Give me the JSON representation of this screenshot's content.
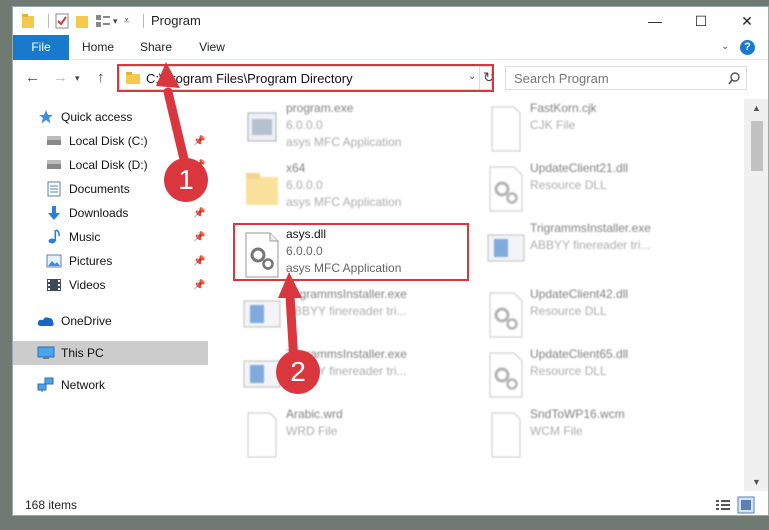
{
  "window": {
    "title": "Program",
    "controls": {
      "minimize": "—",
      "maximize": "☐",
      "close": "✕"
    }
  },
  "ribbon": {
    "tabs": [
      "File",
      "Home",
      "Share",
      "View"
    ],
    "help": "?"
  },
  "address_bar": {
    "path": "C:\\Program Files\\Program Directory"
  },
  "search": {
    "placeholder": "Search Program"
  },
  "sidebar": {
    "items": [
      {
        "label": "Quick access",
        "icon": "star-icon"
      },
      {
        "label": "Local Disk (C:)",
        "icon": "drive-icon",
        "pinned": true
      },
      {
        "label": "Local Disk (D:)",
        "icon": "drive-icon",
        "pinned": true
      },
      {
        "label": "Documents",
        "icon": "documents-icon",
        "pinned": true
      },
      {
        "label": "Downloads",
        "icon": "downloads-icon",
        "pinned": true
      },
      {
        "label": "Music",
        "icon": "music-icon",
        "pinned": true
      },
      {
        "label": "Pictures",
        "icon": "pictures-icon",
        "pinned": true
      },
      {
        "label": "Videos",
        "icon": "videos-icon",
        "pinned": true
      },
      {
        "label": "OneDrive",
        "icon": "onedrive-icon"
      },
      {
        "label": "This PC",
        "icon": "pc-icon",
        "selected": true
      },
      {
        "label": "Network",
        "icon": "network-icon"
      }
    ]
  },
  "files": {
    "col1": [
      {
        "name": "program.exe",
        "version": "6.0.0.0",
        "desc": "asys MFC Application",
        "icon": "exe-icon"
      },
      {
        "name": "x64",
        "version": "6.0.0.0",
        "desc": "asys MFC Application",
        "icon": "folder-icon"
      },
      {
        "name": "asys.dll",
        "version": "6.0.0.0",
        "desc": "asys MFC Application",
        "icon": "dll-icon",
        "highlighted": true
      },
      {
        "name": "TrigrammsInstaller.exe",
        "version": "ABBYY finereader tri...",
        "desc": "",
        "icon": "installer-icon"
      },
      {
        "name": "TrigrammsInstaller.exe",
        "version": "ABBYY finereader tri...",
        "desc": "",
        "icon": "installer-icon"
      },
      {
        "name": "Arabic.wrd",
        "version": "WRD File",
        "desc": "",
        "icon": "file-icon"
      }
    ],
    "col2": [
      {
        "name": "FastKorn.cjk",
        "version": "CJK File",
        "icon": "file-icon"
      },
      {
        "name": "UpdateClient21.dll",
        "version": "Resource DLL",
        "icon": "dll-icon"
      },
      {
        "name": "TrigrammsInstaller.exe",
        "version": "ABBYY finereader tri...",
        "icon": "installer-icon"
      },
      {
        "name": "UpdateClient42.dll",
        "version": "Resource DLL",
        "icon": "dll-icon"
      },
      {
        "name": "UpdateClient65.dll",
        "version": "Resource DLL",
        "icon": "dll-icon"
      },
      {
        "name": "SndToWP16.wcm",
        "version": "WCM File",
        "icon": "file-icon"
      }
    ]
  },
  "annotations": {
    "badge1": "1",
    "badge2": "2"
  },
  "status": {
    "item_count": "168 items"
  },
  "colors": {
    "accent": "#1979ca",
    "highlight": "#d9363e"
  }
}
